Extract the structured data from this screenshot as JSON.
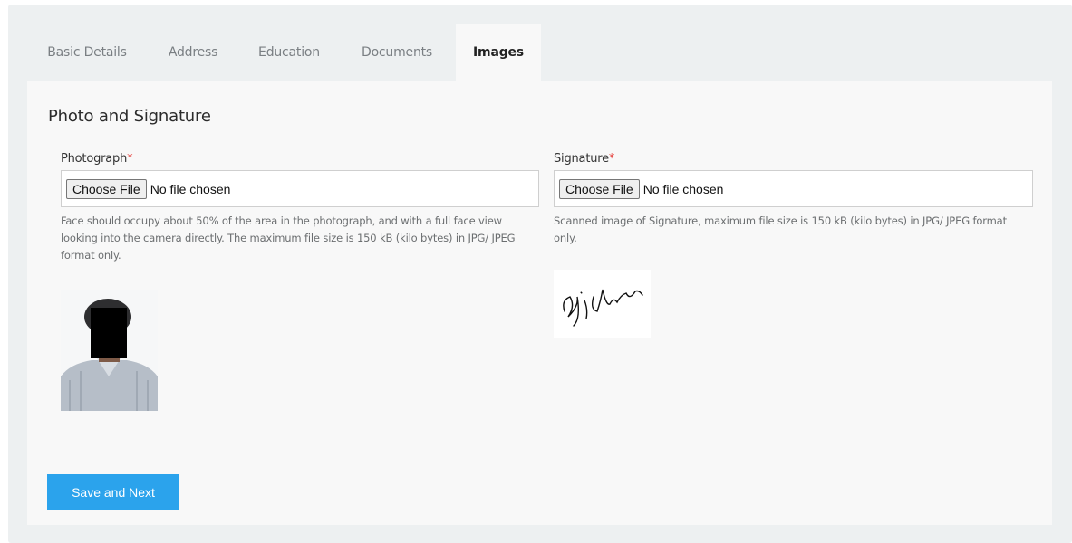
{
  "tabs": [
    {
      "label": "Basic Details"
    },
    {
      "label": "Address"
    },
    {
      "label": "Education"
    },
    {
      "label": "Documents"
    },
    {
      "label": "Images",
      "active": true
    }
  ],
  "section": {
    "title": "Photo and Signature"
  },
  "photograph": {
    "label": "Photograph",
    "required_mark": "*",
    "choose_label": "Choose File",
    "status": "No file chosen",
    "help": "Face should occupy about 50% of the area in the photograph, and with a full face view looking into the camera directly. The maximum file size is 150 kB (kilo bytes) in JPG/ JPEG format only."
  },
  "signature": {
    "label": "Signature",
    "required_mark": "*",
    "choose_label": "Choose File",
    "status": "No file chosen",
    "help": "Scanned image of Signature, maximum file size is 150 kB (kilo bytes) in JPG/ JPEG format only."
  },
  "actions": {
    "save_next": "Save and Next"
  },
  "colors": {
    "accent": "#2ba3ec",
    "required": "#e53935",
    "page_bg": "#edf0f1",
    "panel_bg": "#f8f8f8"
  },
  "icons": [
    "photo-preview",
    "signature-preview"
  ]
}
